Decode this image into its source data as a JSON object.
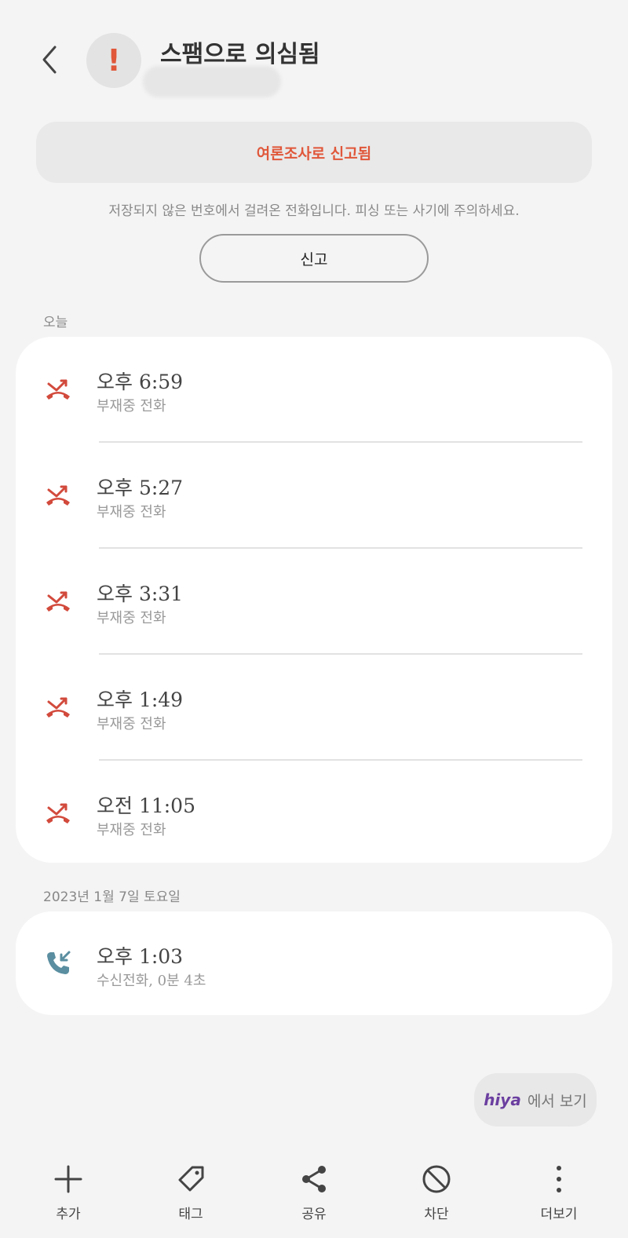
{
  "header": {
    "title": "스팸으로 의심됨",
    "avatar_icon": "exclamation-icon",
    "accent_color": "#e0573a"
  },
  "report_banner": {
    "text": "여론조사로 신고됨"
  },
  "warning_text": "저장되지 않은 번호에서 걸려온 전화입니다. 피싱 또는 사기에 주의하세요.",
  "report_button": {
    "label": "신고"
  },
  "sections": [
    {
      "label": "오늘",
      "calls": [
        {
          "time": "오후 6:59",
          "detail": "부재중 전화",
          "type": "missed"
        },
        {
          "time": "오후 5:27",
          "detail": "부재중 전화",
          "type": "missed"
        },
        {
          "time": "오후 3:31",
          "detail": "부재중 전화",
          "type": "missed"
        },
        {
          "time": "오후 1:49",
          "detail": "부재중 전화",
          "type": "missed"
        },
        {
          "time": "오전 11:05",
          "detail": "부재중 전화",
          "type": "missed"
        }
      ]
    },
    {
      "label": "2023년 1월 7일 토요일",
      "calls": [
        {
          "time": "오후 1:03",
          "detail": "수신전화, 0분 4초",
          "type": "incoming"
        }
      ]
    }
  ],
  "hiya": {
    "logo": "hiya",
    "text": "에서 보기"
  },
  "bottom_nav": [
    {
      "label": "추가",
      "icon": "plus-icon"
    },
    {
      "label": "태그",
      "icon": "tag-icon"
    },
    {
      "label": "공유",
      "icon": "share-icon"
    },
    {
      "label": "차단",
      "icon": "block-icon"
    },
    {
      "label": "더보기",
      "icon": "more-icon"
    }
  ]
}
